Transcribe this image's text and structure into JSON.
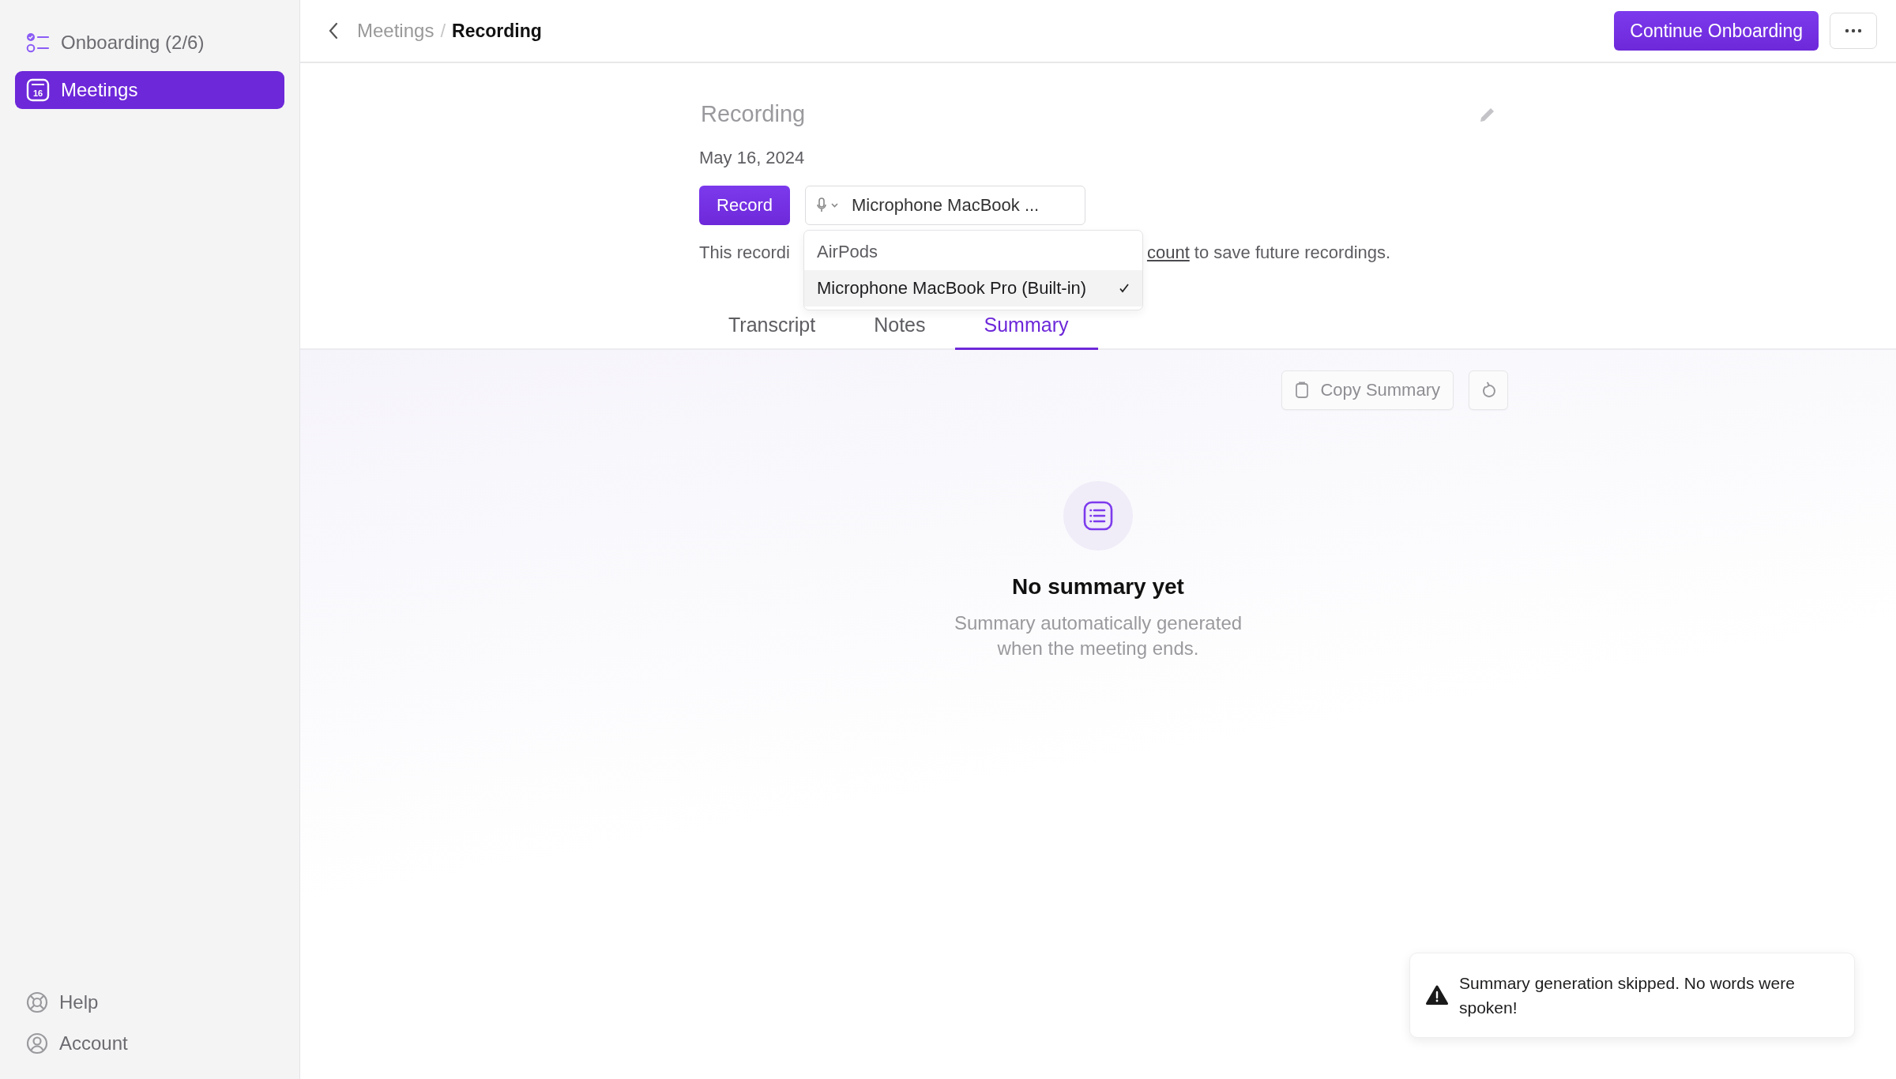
{
  "sidebar": {
    "items": [
      {
        "kind": "checklist",
        "label": "Onboarding (2/6)",
        "selected": false
      },
      {
        "kind": "calendar",
        "icon_text": "16",
        "label": "Meetings",
        "selected": true
      }
    ],
    "footer_items": [
      {
        "kind": "lifebuoy",
        "label": "Help"
      },
      {
        "kind": "person",
        "label": "Account"
      }
    ]
  },
  "header": {
    "breadcrumb": [
      "Meetings",
      "Recording"
    ],
    "separator": "/",
    "primary_button": "Continue Onboarding"
  },
  "recording": {
    "title": "Recording",
    "date": "May 16, 2024",
    "record_button": "Record",
    "microphone_select": "Microphone MacBook ...",
    "notice": {
      "text_before": "This recordi",
      "link": "count",
      "text_after": " to save future recordings."
    },
    "microphone_options": [
      {
        "label": "AirPods",
        "selected": false
      },
      {
        "label": "Microphone MacBook Pro (Built-in)",
        "selected": true
      }
    ],
    "tabs": [
      {
        "label": "Transcript",
        "selected": false
      },
      {
        "label": "Notes",
        "selected": false
      },
      {
        "label": "Summary",
        "selected": true
      }
    ],
    "copy_button": "Copy Summary",
    "empty_state": {
      "title": "No summary yet",
      "message": "Summary automatically generated when the meeting ends."
    }
  },
  "toast": {
    "message": "Summary generation skipped. No words were spoken!"
  }
}
